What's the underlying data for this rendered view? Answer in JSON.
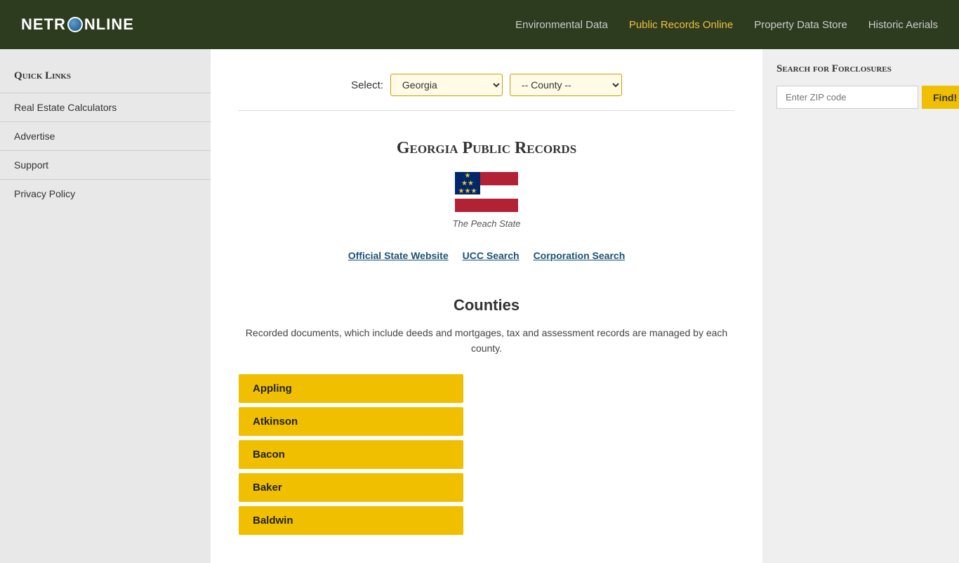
{
  "header": {
    "logo_text_start": "NETR",
    "logo_text_end": "NLINE",
    "nav": [
      {
        "label": "Environmental Data",
        "active": false
      },
      {
        "label": "Public Records Online",
        "active": true
      },
      {
        "label": "Property Data Store",
        "active": false
      },
      {
        "label": "Historic Aerials",
        "active": false
      }
    ]
  },
  "sidebar": {
    "quick_links_title": "Quick Links",
    "links": [
      {
        "label": "Real Estate Calculators"
      },
      {
        "label": "Advertise"
      },
      {
        "label": "Support"
      },
      {
        "label": "Privacy Policy"
      }
    ]
  },
  "select_bar": {
    "label": "Select:",
    "state_selected": "Georgia",
    "county_placeholder": "-- County --",
    "state_options": [
      "Georgia"
    ],
    "county_options": [
      "-- County --"
    ]
  },
  "state_info": {
    "title": "Georgia Public Records",
    "nickname": "The Peach State",
    "links": [
      {
        "label": "Official State Website"
      },
      {
        "label": "UCC Search"
      },
      {
        "label": "Corporation Search"
      }
    ]
  },
  "counties": {
    "title": "Counties",
    "description": "Recorded documents, which include deeds and mortgages, tax and assessment records are managed by each county.",
    "list": [
      "Appling",
      "Atkinson",
      "Bacon",
      "Baker",
      "Baldwin"
    ]
  },
  "right_sidebar": {
    "foreclosure_title": "Search for Forclosures",
    "zip_placeholder": "Enter ZIP code",
    "find_button": "Find!"
  }
}
